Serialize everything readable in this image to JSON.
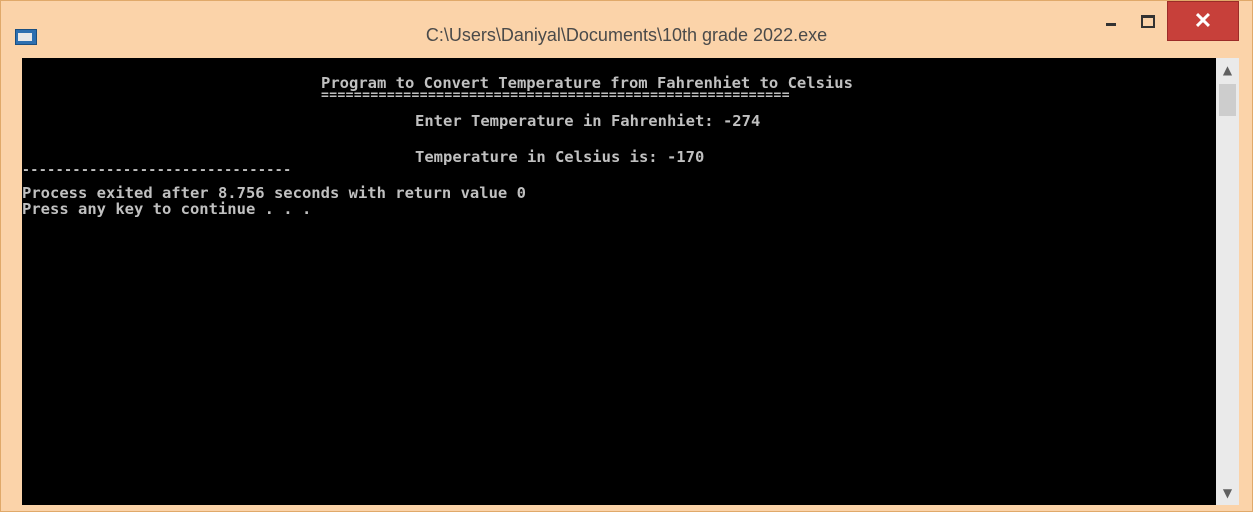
{
  "window": {
    "title": "C:\\Users\\Daniyal\\Documents\\10th grade 2022.exe",
    "close_glyph": "✕"
  },
  "console": {
    "heading": "Program to Convert Temperature from Fahrenhiet to Celsius",
    "rule": "=========================================================",
    "prompt": "Enter Temperature in Fahrenhiet: -274",
    "result": "Temperature in Celsius is: -170",
    "separator": "--------------------------------",
    "exit_message": "Process exited after 8.756 seconds with return value 0",
    "continue_message": "Press any key to continue . . ."
  },
  "scrollbar": {
    "up_glyph": "▲",
    "down_glyph": "▼"
  },
  "colors": {
    "console_bg": "#000000",
    "console_text": "#c0c0c0",
    "close_button": "#c7403a",
    "frame": "#fbd3a9"
  },
  "icons": [
    "app-window-icon",
    "minimize-icon",
    "maximize-icon",
    "close-icon",
    "scroll-up-icon",
    "scroll-down-icon"
  ]
}
